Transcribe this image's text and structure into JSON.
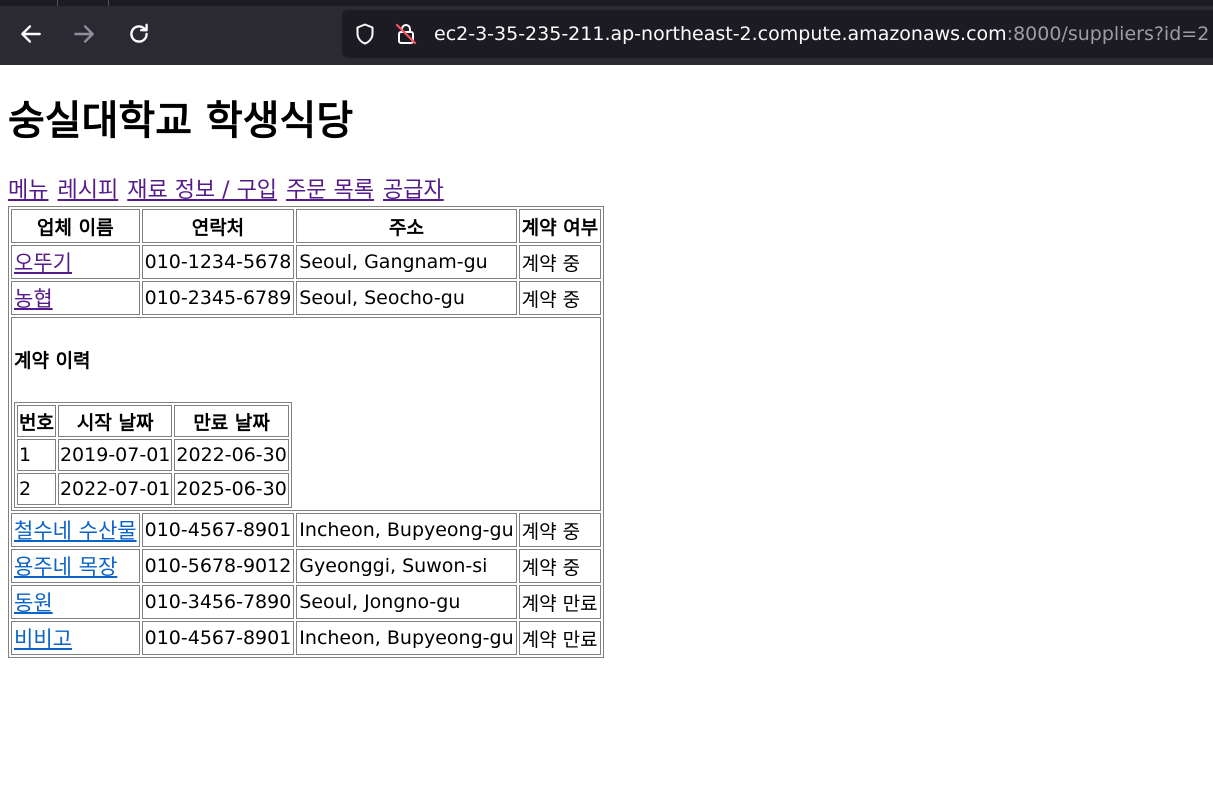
{
  "browser": {
    "url_main": "ec2-3-35-235-211.ap-northeast-2.compute.amazonaws.com",
    "url_rest": ":8000/suppliers?id=2"
  },
  "page": {
    "title": "숭실대학교 학생식당",
    "nav": [
      {
        "label": "메뉴"
      },
      {
        "label": "레시피"
      },
      {
        "label": "재료 정보 / 구입"
      },
      {
        "label": "주문 목록"
      },
      {
        "label": "공급자"
      }
    ]
  },
  "suppliers": {
    "headers": [
      "업체 이름",
      "연락처",
      "주소",
      "계약 여부"
    ],
    "rows": [
      {
        "name": "오뚜기",
        "phone": "010-1234-5678",
        "address": "Seoul, Gangnam-gu",
        "status": "계약 중"
      },
      {
        "name": "농협",
        "phone": "010-2345-6789",
        "address": "Seoul, Seocho-gu",
        "status": "계약 중"
      },
      {
        "name": "철수네 수산물",
        "phone": "010-4567-8901",
        "address": "Incheon, Bupyeong-gu",
        "status": "계약 중"
      },
      {
        "name": "용주네 목장",
        "phone": "010-5678-9012",
        "address": "Gyeonggi, Suwon-si",
        "status": "계약 중"
      },
      {
        "name": "동원",
        "phone": "010-3456-7890",
        "address": "Seoul, Jongno-gu",
        "status": "계약 만료"
      },
      {
        "name": "비비고",
        "phone": "010-4567-8901",
        "address": "Incheon, Bupyeong-gu",
        "status": "계약 만료"
      }
    ]
  },
  "history": {
    "title": "계약 이력",
    "headers": [
      "번호",
      "시작 날짜",
      "만료 날짜"
    ],
    "rows": [
      {
        "no": "1",
        "start": "2019-07-01",
        "end": "2022-06-30"
      },
      {
        "no": "2",
        "start": "2022-07-01",
        "end": "2025-06-30"
      }
    ]
  },
  "colors": {
    "link": "#0b62c7",
    "visited": "#551a8b",
    "toolbar": "#2b2a33",
    "urlbar": "#1c1b22"
  },
  "icons": [
    "back-arrow-icon",
    "forward-arrow-icon",
    "reload-icon",
    "shield-icon",
    "insecure-lock-icon"
  ]
}
